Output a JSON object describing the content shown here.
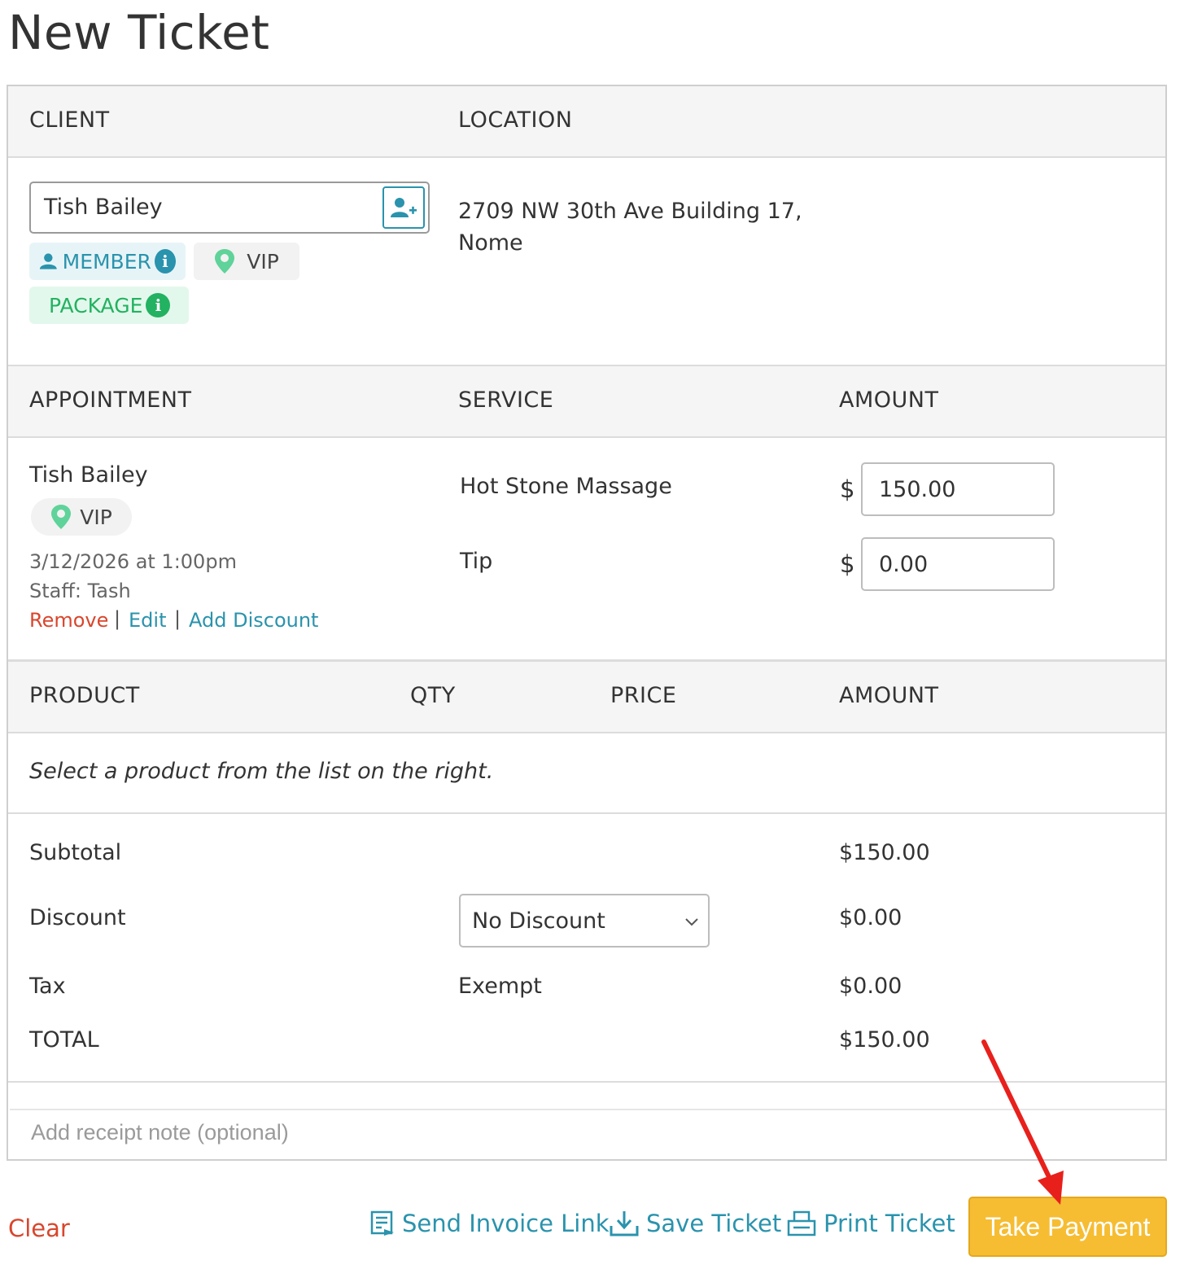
{
  "page": {
    "title": "New Ticket"
  },
  "client_section": {
    "client_header": "CLIENT",
    "location_header": "LOCATION",
    "client_name": "Tish Bailey",
    "badges": {
      "member": "MEMBER",
      "vip": "VIP",
      "package": "PACKAGE"
    },
    "location_lines": [
      "2709 NW 30th Ave Building 17,",
      "Nome"
    ]
  },
  "appointment_section": {
    "headers": {
      "appointment": "APPOINTMENT",
      "service": "SERVICE",
      "amount": "AMOUNT"
    },
    "client_name": "Tish Bailey",
    "badge": "VIP",
    "datetime": "3/12/2026 at 1:00pm",
    "staff": "Staff: Tash",
    "actions": {
      "remove": "Remove",
      "separator": "|",
      "edit": "Edit",
      "add_discount": "Add Discount"
    },
    "service": "Hot Stone Massage",
    "tip_label": "Tip",
    "currency": "$",
    "service_amount": "150.00",
    "tip_amount": "0.00"
  },
  "product_section": {
    "headers": {
      "product": "PRODUCT",
      "qty": "QTY",
      "price": "PRICE",
      "amount": "AMOUNT"
    },
    "empty_text": "Select a product from the list on the right."
  },
  "totals": {
    "subtotal_label": "Subtotal",
    "subtotal": "$150.00",
    "discount_label": "Discount",
    "discount_select": "No Discount",
    "discount": "$0.00",
    "tax_label": "Tax",
    "tax_status": "Exempt",
    "tax": "$0.00",
    "total_label": "TOTAL",
    "total": "$150.00"
  },
  "receipt_note": {
    "placeholder": "Add receipt note (optional)"
  },
  "footer": {
    "clear": "Clear",
    "send_invoice": "Send Invoice Link",
    "save_ticket": "Save Ticket",
    "print_ticket": "Print Ticket",
    "take_payment": "Take Payment"
  },
  "colors": {
    "accent": "#2a93ad",
    "danger": "#d9462d",
    "success": "#22b261",
    "payment_button": "#f6bd33",
    "annotation_arrow": "#e8201c"
  },
  "icons": {
    "add_client": "add-user-icon",
    "member": "person-icon",
    "info": "info-icon",
    "vip": "map-pin-icon",
    "send_invoice": "invoice-icon",
    "save": "download-icon",
    "print": "printer-icon",
    "dropdown": "chevron-down-icon"
  }
}
